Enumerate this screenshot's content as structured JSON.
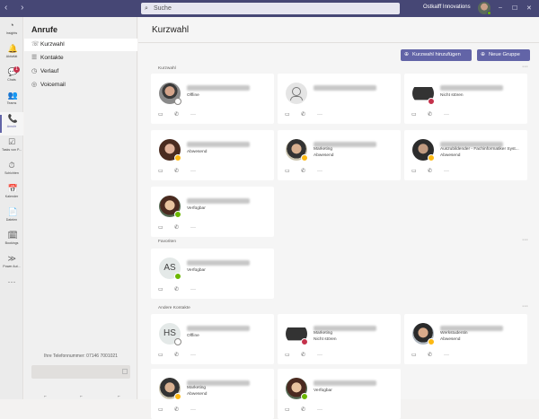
{
  "titlebar": {
    "search_placeholder": "Suche",
    "org_name": "Ostkalff Innovations",
    "window_minimize": "–",
    "window_maximize": "☐",
    "window_close": "✕"
  },
  "rail": {
    "items": [
      {
        "label": "Insights",
        "icon": "bell-icon",
        "glyph": "◔"
      },
      {
        "label": "Aktivität",
        "icon": "bell-icon",
        "glyph": "🔔"
      },
      {
        "label": "Chats",
        "icon": "chat-icon",
        "glyph": "💬",
        "badge": "1"
      },
      {
        "label": "Teams",
        "icon": "teams-icon",
        "glyph": "👥"
      },
      {
        "label": "Anrufe",
        "icon": "phone-icon",
        "glyph": "📞"
      },
      {
        "label": "Tasks von P...",
        "icon": "tasks-icon",
        "glyph": "☑"
      },
      {
        "label": "Schichten",
        "icon": "shifts-icon",
        "glyph": "⏱"
      },
      {
        "label": "Kalender",
        "icon": "calendar-icon",
        "glyph": "📅"
      },
      {
        "label": "Dateien",
        "icon": "files-icon",
        "glyph": "📄"
      },
      {
        "label": "Bookings",
        "icon": "bookings-icon",
        "glyph": "🗓"
      },
      {
        "label": "Power Aut...",
        "icon": "power-automate-icon",
        "glyph": "≫"
      },
      {
        "label": "",
        "icon": "more-icon",
        "glyph": "···"
      }
    ]
  },
  "side": {
    "title": "Anrufe",
    "items": [
      {
        "label": "Kurzwahl",
        "icon": "speed-dial-icon",
        "glyph": "☏"
      },
      {
        "label": "Kontakte",
        "icon": "contacts-icon",
        "glyph": "☰"
      },
      {
        "label": "Verlauf",
        "icon": "history-icon",
        "glyph": "◷"
      },
      {
        "label": "Voicemail",
        "icon": "voicemail-icon",
        "glyph": "◎"
      }
    ],
    "phone_label": "Ihre Telefonnummer: 07146 7001021"
  },
  "main": {
    "title": "Kurzwahl",
    "add_button": "Kurzwahl hinzufügen",
    "group_button": "Neue Gruppe",
    "sections": [
      "Kurzwahl",
      "Favoriten",
      "Andere Kontakte"
    ]
  },
  "cards": [
    {
      "title": "",
      "status": "Offline"
    },
    {
      "title": "",
      "status": ""
    },
    {
      "title": "",
      "status": "Nicht stören"
    },
    {
      "title": "",
      "status": "Abwesend"
    },
    {
      "title": "Marketing",
      "status": "Abwesend"
    },
    {
      "title": "Auszubildender - Fachinformatiker Syst...",
      "status": "Abwesend"
    },
    {
      "title": "",
      "status": "Verfügbar"
    },
    {
      "title": "",
      "status": "Verfügbar",
      "initials": "AS"
    },
    {
      "title": "",
      "status": "Offline",
      "initials": "HS"
    },
    {
      "title": "Marketing",
      "status": "Nicht stören"
    },
    {
      "title": "Werkstudentin",
      "status": "Abwesend"
    },
    {
      "title": "Marketing",
      "status": "Abwesend"
    },
    {
      "title": "",
      "status": "Verfügbar"
    }
  ],
  "card_actions": {
    "video": "▭",
    "call": "✆",
    "more": "···"
  },
  "section_more": "···"
}
